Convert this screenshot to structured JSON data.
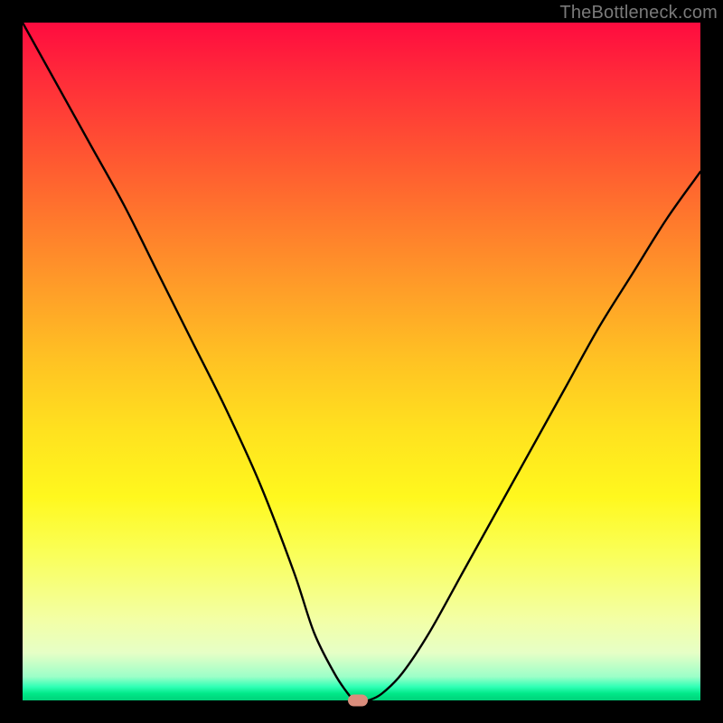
{
  "watermark": "TheBottleneck.com",
  "chart_data": {
    "type": "line",
    "title": "",
    "xlabel": "",
    "ylabel": "",
    "xlim": [
      0,
      100
    ],
    "ylim": [
      0,
      100
    ],
    "series": [
      {
        "name": "bottleneck-curve",
        "x": [
          0,
          5,
          10,
          15,
          20,
          25,
          30,
          35,
          40,
          43,
          46,
          48,
          49,
          50,
          51,
          53,
          56,
          60,
          65,
          70,
          75,
          80,
          85,
          90,
          95,
          100
        ],
        "values": [
          100,
          91,
          82,
          73,
          63,
          53,
          43,
          32,
          19,
          10,
          4,
          1,
          0,
          0,
          0,
          1,
          4,
          10,
          19,
          28,
          37,
          46,
          55,
          63,
          71,
          78
        ]
      }
    ],
    "marker": {
      "x": 49.5,
      "y": 0
    },
    "background_gradient": {
      "top": "#ff0b3f",
      "mid": "#ffe11f",
      "bottom": "#00d27a"
    }
  }
}
